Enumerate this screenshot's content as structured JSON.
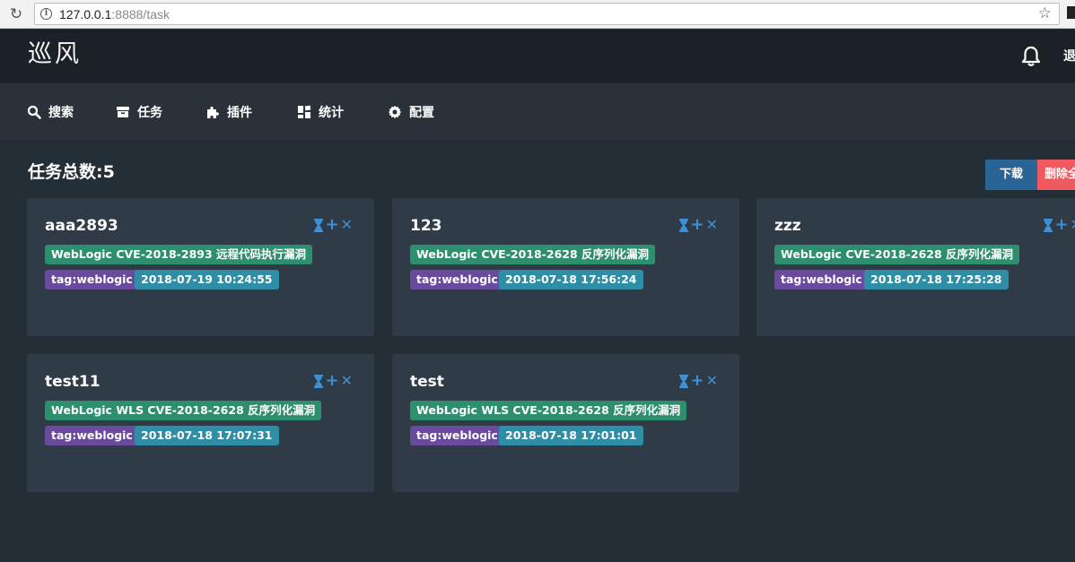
{
  "browser": {
    "url_host": "127.0.0.1",
    "url_rest": ":8888/task"
  },
  "header": {
    "logo": "巡风",
    "logout_label": "退"
  },
  "nav": [
    {
      "label": "搜索",
      "icon": "search-icon"
    },
    {
      "label": "任务",
      "icon": "archive-icon"
    },
    {
      "label": "插件",
      "icon": "puzzle-icon"
    },
    {
      "label": "统计",
      "icon": "dashboard-icon"
    },
    {
      "label": "配置",
      "icon": "gear-icon"
    }
  ],
  "content": {
    "title": "任务总数:5",
    "download_label": "下载",
    "delete_label": "删除全"
  },
  "tasks": [
    {
      "name": "aaa2893",
      "vuln": "WebLogic CVE-2018-2893 远程代码执行漏洞",
      "tag": "tag:weblogic",
      "time": "2018-07-19 10:24:55"
    },
    {
      "name": "123",
      "vuln": "WebLogic CVE-2018-2628 反序列化漏洞",
      "tag": "tag:weblogic",
      "time": "2018-07-18 17:56:24"
    },
    {
      "name": "zzz",
      "vuln": "WebLogic CVE-2018-2628 反序列化漏洞",
      "tag": "tag:weblogic",
      "time": "2018-07-18 17:25:28"
    },
    {
      "name": "test11",
      "vuln": "WebLogic WLS CVE-2018-2628 反序列化漏洞",
      "tag": "tag:weblogic",
      "time": "2018-07-18 17:07:31"
    },
    {
      "name": "test",
      "vuln": "WebLogic WLS CVE-2018-2628 反序列化漏洞",
      "tag": "tag:weblogic",
      "time": "2018-07-18 17:01:01"
    }
  ],
  "colors": {
    "vuln_tag": "#2e8f6f",
    "label_tag": "#6a4a9c",
    "time_tag": "#2f8ea5",
    "action_icon": "#3d8fd6",
    "download_button": "#2a6496",
    "delete_button": "#f05a5f"
  }
}
